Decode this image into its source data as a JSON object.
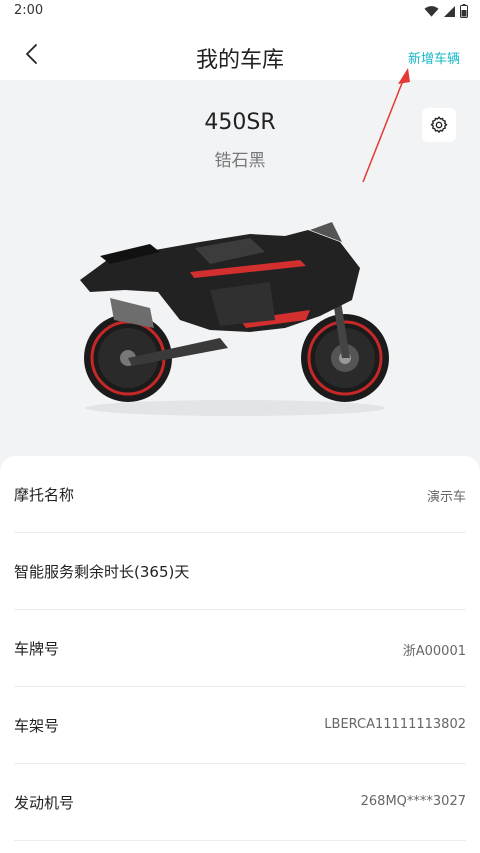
{
  "status": {
    "time": "2:00"
  },
  "nav": {
    "title": "我的车库",
    "add_vehicle": "新增车辆"
  },
  "vehicle": {
    "model": "450SR",
    "color_name": "锆石黑"
  },
  "info_rows": [
    {
      "label": "摩托名称",
      "value": "演示车"
    },
    {
      "label": "智能服务剩余时长(365)天",
      "value": ""
    },
    {
      "label": "车牌号",
      "value": "浙A00001"
    },
    {
      "label": "车架号",
      "value": "LBERCA11111113802"
    },
    {
      "label": "发动机号",
      "value": "268MQ****3027"
    }
  ],
  "colors": {
    "accent": "#17b8c7",
    "annotation": "#e53935",
    "bike_red": "#d32f2f"
  },
  "icons": [
    "wifi-icon",
    "signal-icon",
    "battery-icon",
    "back-icon",
    "gear-icon"
  ]
}
